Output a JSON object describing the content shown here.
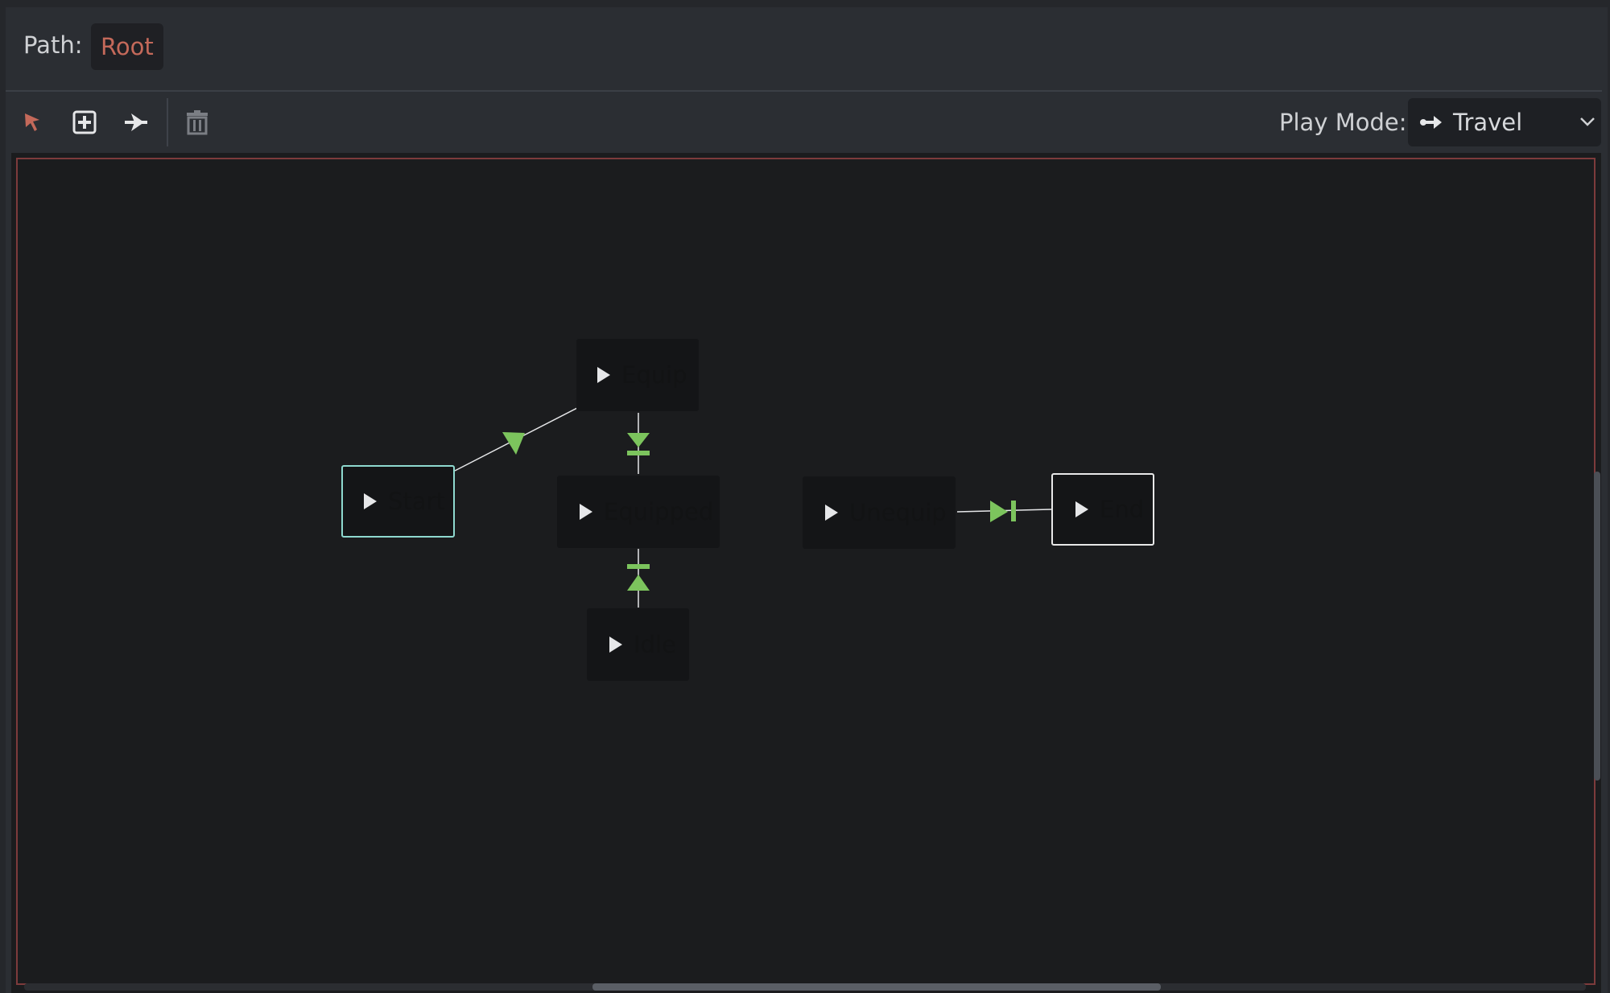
{
  "path": {
    "label": "Path:",
    "root": "Root"
  },
  "toolbar": {
    "select_tool": "select-arrow-icon",
    "add_node_tool": "add-node-icon",
    "connect_tool": "connect-transition-icon",
    "delete_tool": "trash-icon",
    "play_mode_label": "Play Mode:",
    "play_mode_value": "Travel"
  },
  "colors": {
    "accent_path": "#c4695a",
    "transition_green": "#7cc45d",
    "start_border": "#8ed9cf",
    "canvas_border": "#7d3b3c"
  },
  "graph": {
    "nodes": {
      "start": "Start",
      "equip": "Equip",
      "equipped": "Equipped",
      "idle": "Idle",
      "unequip": "Unequip",
      "end": "End"
    },
    "transitions": [
      {
        "from": "Start",
        "to": "Equip",
        "type": "immediate"
      },
      {
        "from": "Equip",
        "to": "Equipped",
        "type": "at-end"
      },
      {
        "from": "Idle",
        "to": "Equipped",
        "type": "at-end"
      },
      {
        "from": "Unequip",
        "to": "End",
        "type": "at-end"
      }
    ]
  }
}
